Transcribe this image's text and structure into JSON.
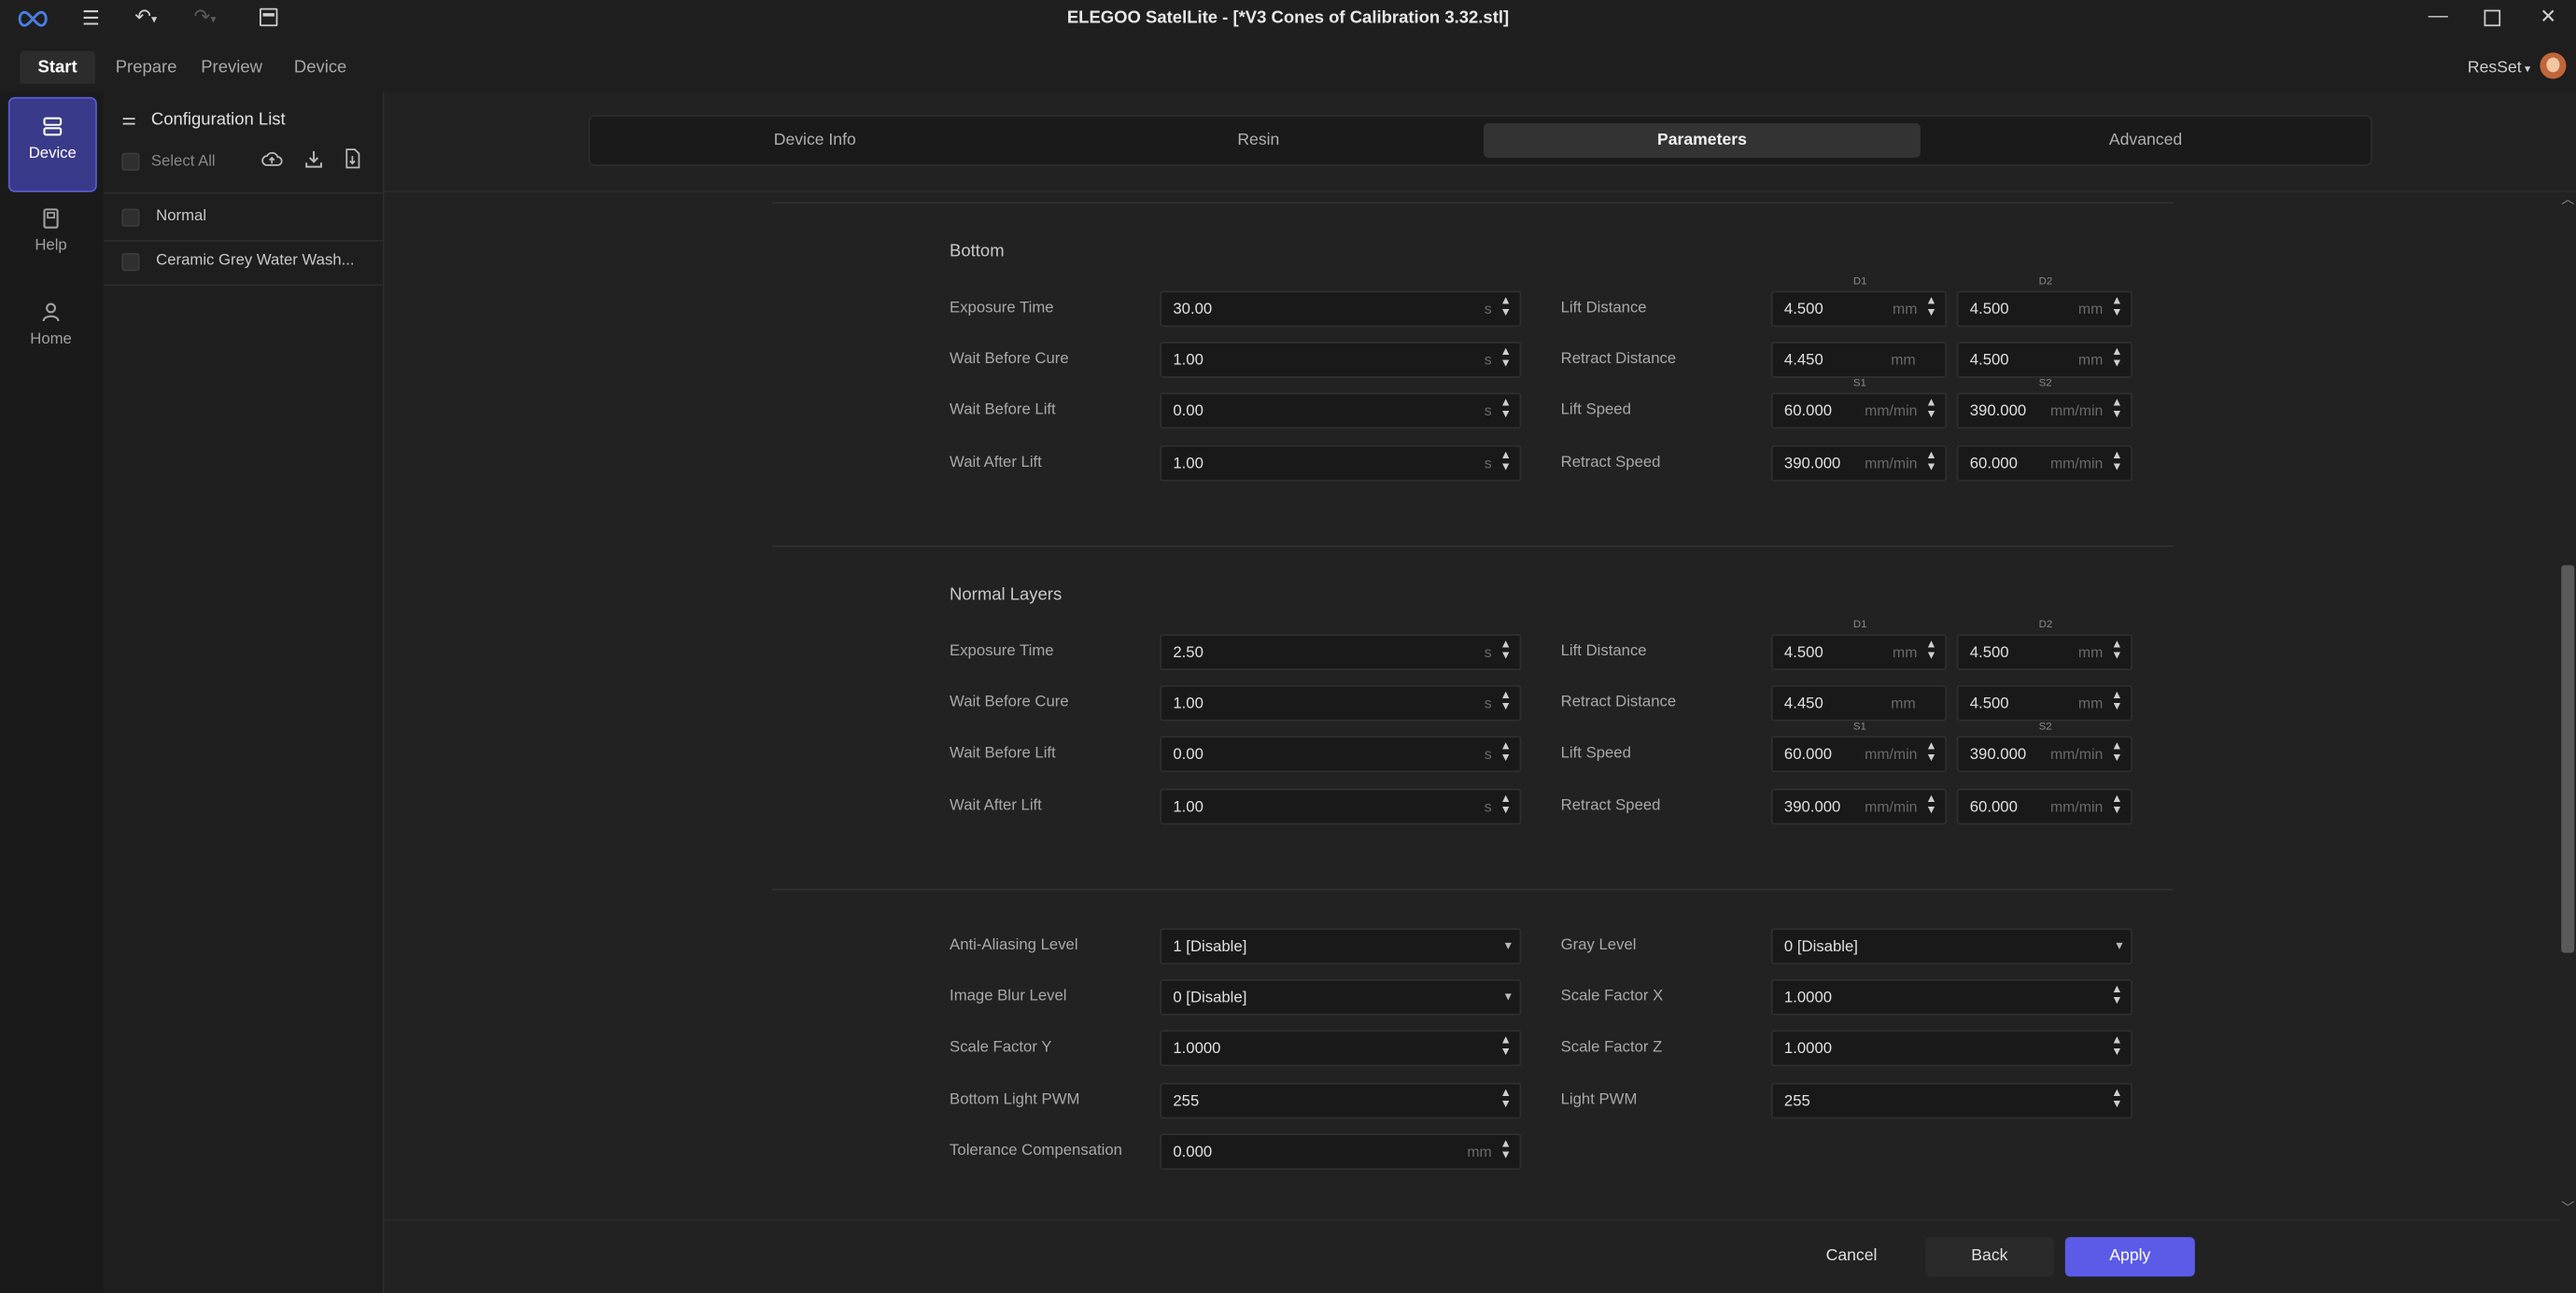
{
  "window": {
    "title": "ELEGOO SatelLite - [*V3 Cones of Calibration 3.32.stl]"
  },
  "menu": {
    "tabs": [
      "Start",
      "Prepare",
      "Preview",
      "Device"
    ],
    "user": "ResSet"
  },
  "rail": {
    "items": [
      "Device",
      "Help",
      "Home"
    ]
  },
  "config": {
    "title": "Configuration List",
    "select_all": "Select All",
    "items": [
      "Normal",
      "Ceramic Grey Water Wash..."
    ]
  },
  "tabs": [
    "Device Info",
    "Resin",
    "Parameters",
    "Advanced"
  ],
  "sections": [
    {
      "title": "Bottom",
      "left": [
        {
          "label": "Exposure Time",
          "value": "30.00",
          "unit": "s"
        },
        {
          "label": "Wait Before Cure",
          "value": "1.00",
          "unit": "s"
        },
        {
          "label": "Wait Before Lift",
          "value": "0.00",
          "unit": "s"
        },
        {
          "label": "Wait After Lift",
          "value": "1.00",
          "unit": "s"
        }
      ],
      "right": [
        {
          "label": "Lift Distance",
          "v1": "4.500",
          "v2": "4.500",
          "unit": "mm",
          "tag1": "D1",
          "tag2": "D2"
        },
        {
          "label": "Retract Distance",
          "v1": "4.450",
          "v2": "4.500",
          "unit": "mm"
        },
        {
          "label": "Lift Speed",
          "v1": "60.000",
          "v2": "390.000",
          "unit": "mm/min",
          "tag1": "S1",
          "tag2": "S2"
        },
        {
          "label": "Retract Speed",
          "v1": "390.000",
          "v2": "60.000",
          "unit": "mm/min"
        }
      ]
    },
    {
      "title": "Normal Layers",
      "left": [
        {
          "label": "Exposure Time",
          "value": "2.50",
          "unit": "s"
        },
        {
          "label": "Wait Before Cure",
          "value": "1.00",
          "unit": "s"
        },
        {
          "label": "Wait Before Lift",
          "value": "0.00",
          "unit": "s"
        },
        {
          "label": "Wait After Lift",
          "value": "1.00",
          "unit": "s"
        }
      ],
      "right": [
        {
          "label": "Lift Distance",
          "v1": "4.500",
          "v2": "4.500",
          "unit": "mm",
          "tag1": "D1",
          "tag2": "D2"
        },
        {
          "label": "Retract Distance",
          "v1": "4.450",
          "v2": "4.500",
          "unit": "mm"
        },
        {
          "label": "Lift Speed",
          "v1": "60.000",
          "v2": "390.000",
          "unit": "mm/min",
          "tag1": "S1",
          "tag2": "S2"
        },
        {
          "label": "Retract Speed",
          "v1": "390.000",
          "v2": "60.000",
          "unit": "mm/min"
        }
      ]
    }
  ],
  "other": [
    {
      "l_label": "Anti-Aliasing Level",
      "l_value": "1 [Disable]",
      "l_kind": "dropdown",
      "r_label": "Gray Level",
      "r_value": "0 [Disable]",
      "r_kind": "dropdown"
    },
    {
      "l_label": "Image Blur Level",
      "l_value": "0 [Disable]",
      "l_kind": "dropdown",
      "r_label": "Scale Factor X",
      "r_value": "1.0000",
      "r_kind": "spin"
    },
    {
      "l_label": "Scale Factor Y",
      "l_value": "1.0000",
      "l_kind": "spin",
      "r_label": "Scale Factor Z",
      "r_value": "1.0000",
      "r_kind": "spin"
    },
    {
      "l_label": "Bottom Light PWM",
      "l_value": "255",
      "l_kind": "spin",
      "r_label": "Light PWM",
      "r_value": "255",
      "r_kind": "spin"
    },
    {
      "l_label": "Tolerance Compensation",
      "l_value": "0.000",
      "l_kind": "spin",
      "l_unit": "mm"
    }
  ],
  "buttons": {
    "cancel": "Cancel",
    "back": "Back",
    "apply": "Apply"
  },
  "colors": {
    "accent": "#5b5be8",
    "rail_active": "#3a3a8a"
  }
}
